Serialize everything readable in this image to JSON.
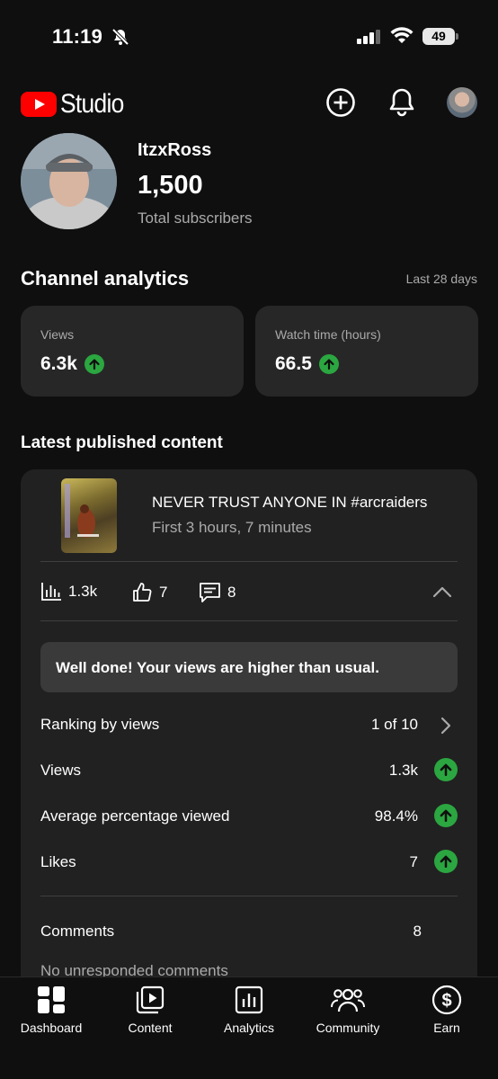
{
  "status_bar": {
    "time": "11:19",
    "battery": "49"
  },
  "header": {
    "logo_text": "Studio"
  },
  "channel": {
    "name": "ItzxRoss",
    "subscriber_count": "1,500",
    "subscriber_label": "Total subscribers"
  },
  "analytics": {
    "title": "Channel analytics",
    "range": "Last 28 days",
    "cards": [
      {
        "label": "Views",
        "value": "6.3k",
        "trend": "up"
      },
      {
        "label": "Watch time (hours)",
        "value": "66.5",
        "trend": "up"
      }
    ]
  },
  "latest": {
    "title": "Latest published content",
    "video_title": "NEVER TRUST ANYONE IN #arcraiders",
    "video_sub": "First 3 hours, 7 minutes",
    "metrics": {
      "views": "1.3k",
      "likes": "7",
      "comments": "8"
    },
    "note": "Well done! Your views are higher than usual.",
    "rows": [
      {
        "label": "Ranking by views",
        "value": "1 of 10"
      },
      {
        "label": "Views",
        "value": "1.3k",
        "trend": "up"
      },
      {
        "label": "Average percentage viewed",
        "value": "98.4%",
        "trend": "up"
      },
      {
        "label": "Likes",
        "value": "7",
        "trend": "up"
      }
    ],
    "comments": {
      "label": "Comments",
      "value": "8",
      "note": "No unresponded comments"
    }
  },
  "nav": [
    {
      "label": "Dashboard",
      "icon": "dashboard-icon"
    },
    {
      "label": "Content",
      "icon": "content-icon"
    },
    {
      "label": "Analytics",
      "icon": "analytics-icon"
    },
    {
      "label": "Community",
      "icon": "community-icon"
    },
    {
      "label": "Earn",
      "icon": "earn-icon"
    }
  ],
  "colors": {
    "background": "#0f0f0f",
    "card": "#272727",
    "brand_red": "#ff0000",
    "trend_green": "#2ba640"
  }
}
